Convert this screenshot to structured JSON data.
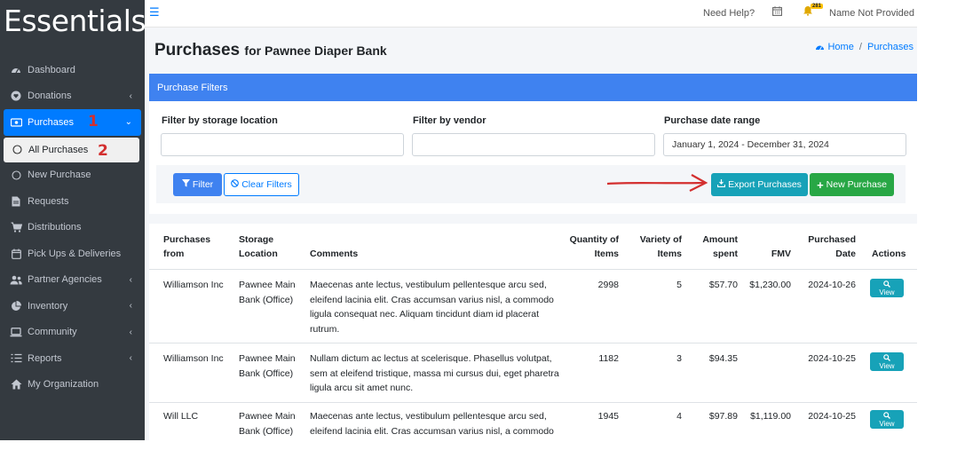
{
  "brand": "Essentials",
  "sidebar": {
    "items": [
      {
        "label": "Dashboard",
        "icon": "dashboard-icon"
      },
      {
        "label": "Donations",
        "icon": "heart-icon"
      },
      {
        "label": "Purchases",
        "icon": "money-icon"
      },
      {
        "label": "All Purchases",
        "icon": "circle-icon"
      },
      {
        "label": "New Purchase",
        "icon": "circle-icon"
      },
      {
        "label": "Requests",
        "icon": "file-icon"
      },
      {
        "label": "Distributions",
        "icon": "cart-icon"
      },
      {
        "label": "Pick Ups & Deliveries",
        "icon": "calendar-icon"
      },
      {
        "label": "Partner Agencies",
        "icon": "users-icon"
      },
      {
        "label": "Inventory",
        "icon": "pie-icon"
      },
      {
        "label": "Community",
        "icon": "laptop-icon"
      },
      {
        "label": "Reports",
        "icon": "list-icon"
      },
      {
        "label": "My Organization",
        "icon": "org-icon"
      }
    ],
    "markers": [
      "1",
      "2"
    ]
  },
  "topbar": {
    "help": "Need Help?",
    "badge": "281",
    "user": "Name Not Provided"
  },
  "page": {
    "title": "Purchases",
    "subtitle": "for Pawnee Diaper Bank",
    "breadcrumb": {
      "home": "Home",
      "sep": "/",
      "current": "Purchases"
    }
  },
  "filters": {
    "header": "Purchase Filters",
    "storage_label": "Filter by storage location",
    "storage_value": "",
    "vendor_label": "Filter by vendor",
    "vendor_value": "",
    "date_label": "Purchase date range",
    "date_value": "January 1, 2024 - December 31, 2024",
    "filter_btn": "Filter",
    "clear_btn": "Clear Filters",
    "export_btn": "Export Purchases",
    "new_btn": "New Purchase"
  },
  "table": {
    "headers": {
      "from": "Purchases from",
      "storage": "Storage Location",
      "comments": "Comments",
      "qty": "Quantity of Items",
      "variety": "Variety of Items",
      "amount": "Amount spent",
      "fmv": "FMV",
      "date": "Purchased Date",
      "actions": "Actions"
    },
    "rows": [
      {
        "from": "Williamson Inc",
        "storage": "Pawnee Main Bank (Office)",
        "comments": "Maecenas ante lectus, vestibulum pellentesque arcu sed, eleifend lacinia elit. Cras accumsan varius nisl, a commodo ligula consequat nec. Aliquam tincidunt diam id placerat rutrum.",
        "qty": "2998",
        "variety": "5",
        "amount": "$57.70",
        "fmv": "$1,230.00",
        "date": "2024-10-26",
        "action": "View"
      },
      {
        "from": "Williamson Inc",
        "storage": "Pawnee Main Bank (Office)",
        "comments": "Nullam dictum ac lectus at scelerisque. Phasellus volutpat, sem at eleifend tristique, massa mi cursus dui, eget pharetra ligula arcu sit amet nunc.",
        "qty": "1182",
        "variety": "3",
        "amount": "$94.35",
        "fmv": "",
        "date": "2024-10-25",
        "action": "View"
      },
      {
        "from": "Will LLC",
        "storage": "Pawnee Main Bank (Office)",
        "comments": "Maecenas ante lectus, vestibulum pellentesque arcu sed, eleifend lacinia elit. Cras accumsan varius nisl, a commodo",
        "qty": "1945",
        "variety": "4",
        "amount": "$97.89",
        "fmv": "$1,119.00",
        "date": "2024-10-25",
        "action": "View"
      }
    ]
  },
  "colors": {
    "sidebar": "#343a40",
    "primary": "#3f82f0",
    "info": "#17a2b8",
    "success": "#28a745",
    "annotation": "#d32f2f"
  }
}
